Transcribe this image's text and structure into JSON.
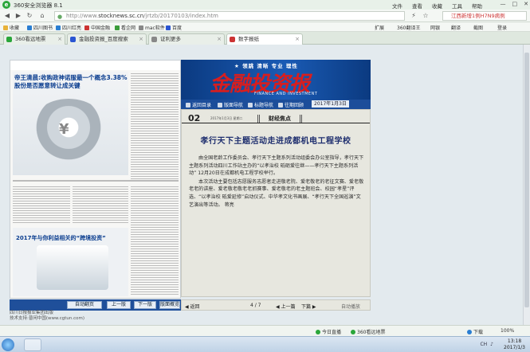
{
  "browser": {
    "title": "360安全浏览器 8.1",
    "menus": [
      "文件",
      "查看",
      "收藏",
      "工具",
      "帮助"
    ],
    "url_prefix": "http://www.",
    "url_domain": "stocknews.sc.cn",
    "url_path": "/jrtzb/20170103/index.htm",
    "search_text": "江西新增1例H7N9病例"
  },
  "favorites": [
    {
      "label": "收藏",
      "color": "#e8b23a"
    },
    {
      "label": "四川图书",
      "color": "#2a7ed2"
    },
    {
      "label": "四川红亮",
      "color": "#2a7ed2"
    },
    {
      "label": "中国金融",
      "color": "#c33"
    },
    {
      "label": "看企网",
      "color": "#3a9c3a"
    },
    {
      "label": "mac软件",
      "color": "#888"
    },
    {
      "label": "百度",
      "color": "#2a55d2"
    }
  ],
  "favorites_right": [
    "扩展",
    "360翻译王",
    "网银",
    "翻译",
    "截图",
    "登录"
  ],
  "tabs": [
    {
      "label": "360看远地票",
      "active": false,
      "color": "#2aa63a"
    },
    {
      "label": "金融投资报_百度搜索",
      "active": false,
      "color": "#2a55d2"
    },
    {
      "label": "证利更多",
      "active": false,
      "color": "#888"
    },
    {
      "label": "数字报纸",
      "active": true,
      "color": "#c33"
    }
  ],
  "thumbnail": {
    "story1_headline": "帝王清晨:收购政神诺服最一个概念3.38%股份是否愿意转让成关键",
    "story2_headline": "2017年与你利益相关的“跨境投资”",
    "symbol": "¥"
  },
  "thumb_controls": {
    "auto": "自动翻页",
    "prev": "上一版",
    "next": "下一版",
    "layout": "版面概览"
  },
  "thumb_footer": [
    "四川日报报业集团出版",
    "技术支持:普闲中国(www.cgtun.com)"
  ],
  "banner": {
    "slogan": "★ 领跳  清晰  专业  理性",
    "logo": "金融投资报",
    "english": "FINANCE AND INVESTMENT"
  },
  "nav": {
    "items": [
      "返回目录",
      "版面导航",
      "标题导航",
      "往期回顾"
    ],
    "date": "2017年1月3日"
  },
  "article": {
    "page_no": "02",
    "page_info": "2017年1月3日 星期二",
    "section": "财经焦点",
    "title": "孝行天下主题活动走进成都机电工程学校",
    "paragraphs": [
      "由全国老龄工作委员会、孝行天下主题系列活动组委会办公室指导，孝行天下主题系列活动四川工作站主办的“以孝治校 砥砺爱往继——孝行天下主题系列活动” 12月20日在成都机电工程学校举行。",
      "本次活动主要包括志愿服务志愿者走进敬老院、爱老敬老的老征文赛、爱老敬老老的讲座、爱老敬老敬老老抓赛事、爱老敬老的老主题班会、校园“孝星”评选、“以孝治校 砥爱延修”启动仪式、中华孝文化书画展、“孝行天下全国巡演”文艺演出等活动。  蒋亮"
    ]
  },
  "page_controls": {
    "back": "返回",
    "pager": "4 / 7",
    "prev": "上一篇",
    "next": "下篇",
    "autoplay": "自动播放"
  },
  "status": {
    "items": [
      "今日直播",
      "360看远地票",
      "下载",
      "100%"
    ]
  },
  "taskbar": {
    "time": "13:18",
    "date": "2017/1/3",
    "tray": "CH"
  }
}
